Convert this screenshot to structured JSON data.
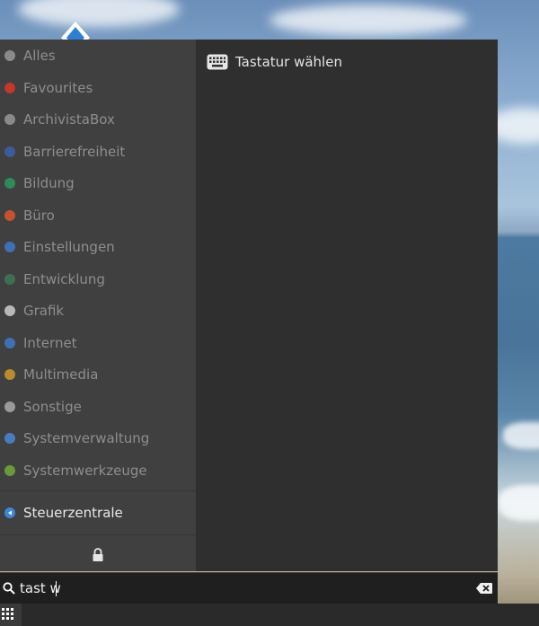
{
  "sidebar": {
    "categories": [
      {
        "label": "Alles",
        "icon": "star-icon",
        "color": "#8a8a8a"
      },
      {
        "label": "Favourites",
        "icon": "heart-icon",
        "color": "#c0392b"
      },
      {
        "label": "ArchivistaBox",
        "icon": "home-icon",
        "color": "#8a8a8a"
      },
      {
        "label": "Barrierefreiheit",
        "icon": "accessibility-icon",
        "color": "#3d5a99"
      },
      {
        "label": "Bildung",
        "icon": "education-icon",
        "color": "#2e8b57"
      },
      {
        "label": "Büro",
        "icon": "office-icon",
        "color": "#c0542e"
      },
      {
        "label": "Einstellungen",
        "icon": "settings-icon",
        "color": "#3f6fb5"
      },
      {
        "label": "Entwicklung",
        "icon": "development-icon",
        "color": "#3e6f52"
      },
      {
        "label": "Grafik",
        "icon": "graphics-icon",
        "color": "#b8b8b8"
      },
      {
        "label": "Internet",
        "icon": "internet-icon",
        "color": "#3f6fb5"
      },
      {
        "label": "Multimedia",
        "icon": "multimedia-icon",
        "color": "#b98a2e"
      },
      {
        "label": "Sonstige",
        "icon": "other-icon",
        "color": "#9a9a9a"
      },
      {
        "label": "Systemverwaltung",
        "icon": "system-admin-icon",
        "color": "#4a7bc0"
      },
      {
        "label": "Systemwerkzeuge",
        "icon": "system-tools-icon",
        "color": "#6a9a3a"
      }
    ],
    "control_center": {
      "label": "Steuerzentrale",
      "icon": "control-center-icon",
      "color": "#3f86d9"
    },
    "lock_icon": "lock-icon"
  },
  "results": [
    {
      "label": "Tastatur wählen",
      "icon": "keyboard-icon"
    }
  ],
  "search": {
    "value": "tast w",
    "search_icon": "search-icon",
    "clear_icon": "clear-text-icon"
  },
  "taskbar": {
    "launcher_icon": "app-grid-icon"
  }
}
